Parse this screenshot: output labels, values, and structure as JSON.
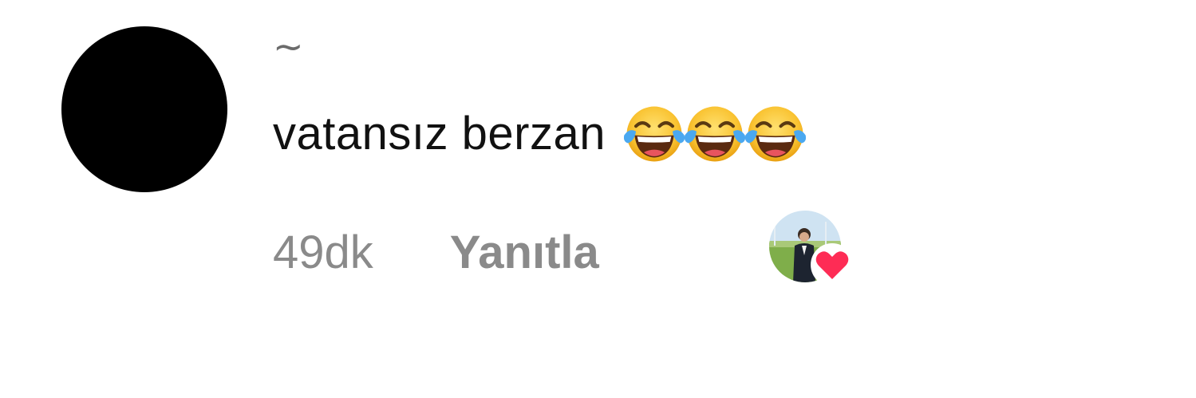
{
  "comment": {
    "username": "~",
    "text": "vatansız berzan",
    "emojis": [
      "face-with-tears-of-joy-icon",
      "face-with-tears-of-joy-icon",
      "face-with-tears-of-joy-icon"
    ],
    "time": "49dk",
    "reply_label": "Yanıtla"
  },
  "colors": {
    "avatar": "#000000",
    "text": "#111111",
    "meta": "#8a8a8a",
    "heart": "#fe2c55"
  }
}
